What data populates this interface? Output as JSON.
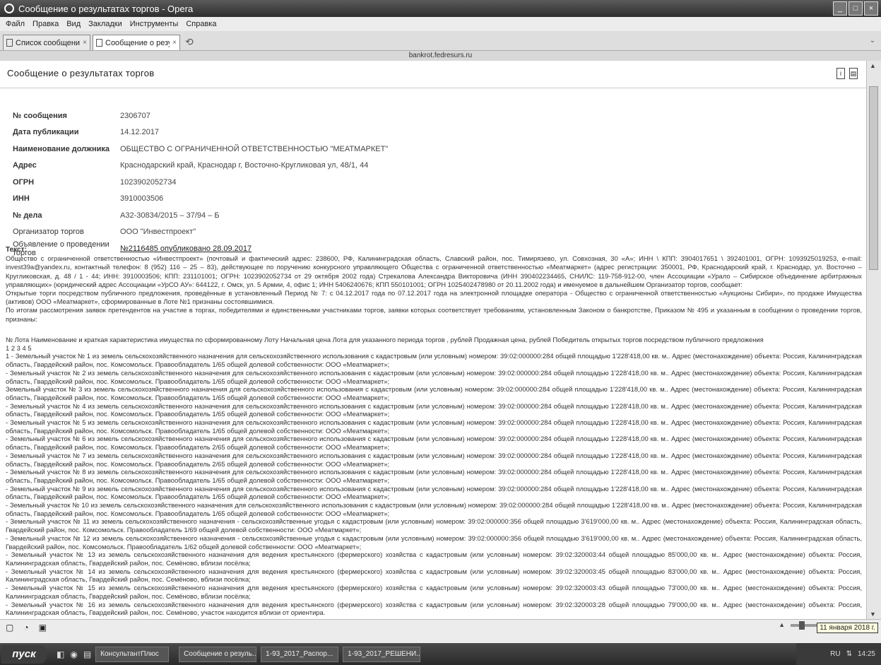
{
  "window": {
    "title": "Сообщение о результатах торгов - Opera",
    "controls": [
      "_",
      "□",
      "×"
    ]
  },
  "menu": [
    "Файл",
    "Правка",
    "Вид",
    "Закладки",
    "Инструменты",
    "Справка"
  ],
  "tabs": [
    {
      "label": "Список сообщений о ба...",
      "close": "×"
    },
    {
      "label": "Сообщение о результа...",
      "close": "×"
    }
  ],
  "address": "bankrot.fedresurs.ru",
  "page": {
    "title": "Сообщение о результатах торгов",
    "fields": [
      {
        "label": "№ сообщения",
        "value": "2306707"
      },
      {
        "label": "Дата публикации",
        "value": "14.12.2017"
      },
      {
        "label": "Наименование должника",
        "value": "ОБЩЕСТВО С ОГРАНИЧЕННОЙ ОТВЕТСТВЕННОСТЬЮ \"МЕАТМАРКЕТ\""
      },
      {
        "label": "Адрес",
        "value": "Краснодарский край, Краснодар г, Восточно-Кругликовая ул, 48/1, 44"
      },
      {
        "label": "ОГРН",
        "value": "1023902052734"
      },
      {
        "label": "ИНН",
        "value": "3910003506"
      },
      {
        "label": "№ дела",
        "value": "А32-30834/2015 – 37/94 – Б"
      },
      {
        "label": "Организатор торгов",
        "value": "ООО \"Инвестпроект\""
      },
      {
        "label": "Объявление о проведении торгов",
        "value": "№2116485 опубликовано 28.09.2017"
      }
    ],
    "text_heading": "Текст:",
    "text_paragraphs": [
      "Общество с ограниченной ответственностью «Инвестпроект» (почтовый и фактический адрес: 238600, РФ, Калининградская область, Славский район, пос. Тимирязево, ул. Совхозная, 30 «А»; ИНН \\ КПП: 3904017651 \\ 392401001, ОГРН: 1093925019253, e-mail: invest39a@yandex.ru, контактный телефон: 8 (952) 116 – 25 – 83), действующее по поручению конкурсного управляющего Общества с ограниченной ответственностью «Меатмаркет» (адрес регистрации: 350001, РФ, Краснодарский край, г. Краснодар, ул. Восточно – Кругликовская, д. 48 / 1 - 44; ИНН: 3910003506; КПП: 231101001; ОГРН: 1023902052734 от 29 октября 2002 года) Стрекалова Александра Викторовича (ИНН 390402234465, СНИЛС: 119-758-912-00, член Ассоциации «Урало – Сибирское объединение арбитражных управляющих» (юридический адрес Ассоциации «УрСО АУ»: 644122, г. Омск, ул. 5 Армии, 4, офис 1; ИНН 5406240676; КПП 550101001; ОГРН 1025402478980 от 20.11.2002 года) и именуемое в дальнейшем Организатор торгов, сообщает:",
      "Открытые торги посредством публичного предложения, проведённые в установленный Период № 7: с 04.12.2017 года по 07.12.2017 года на электронной площадке оператора - Общество с ограниченной ответственностью «Аукционы Сибири», по продаже Имущества (активов) ООО «Меатмаркет», сформированные в Лоте №1 признаны состоявшимися.",
      "По итогам рассмотрения заявок претендентов на участие в торгах, победителями и единственными участниками торгов, заявки которых соответствует требованиям, установленным Законом о банкротстве, Приказом № 495 и указанным в сообщении о проведении торгов, признаны:"
    ],
    "table_header": "№ Лота Наименование и краткая характеристика имущества по сформированному Лоту Начальная цена Лота для указанного периода торгов , рублей Продажная цена, рублей Победитель открытых торгов посредством публичного предложения",
    "table_columns": "1 2 3 4 5",
    "lots": [
      "1 - Земельный участок № 1 из земель сельскохозяйственного назначения для сельскохозяйственного использования с кадастровым (или условным) номером: 39:02:000000:284 общей площадью 1'228'418,00 кв. м.. Адрес (местонахождение) объекта: Россия, Калининградская область, Гвардейский район, пос. Комсомольск. Правообладатель 1/65 общей долевой собственности: ООО «Меатмаркет»;",
      "- Земельный участок № 2 из земель сельскохозяйственного назначения для сельскохозяйственного использования с кадастровым (или условным) номером: 39:02:000000:284 общей площадью 1'228'418,00 кв. м.. Адрес (местонахождение) объекта: Россия, Калининградская область, Гвардейский район, пос. Комсомольск. Правообладатель 1/65 общей долевой собственности: ООО «Меатмаркет»;",
      "Земельный участок № 3 из земель сельскохозяйственного назначения для сельскохозяйственного использования с кадастровым (или условным) номером: 39:02:000000:284 общей площадью 1'228'418,00 кв. м.. Адрес (местонахождение) объекта: Россия, Калининградская область, Гвардейский район, пос. Комсомольск. Правообладатель 1/65 общей долевой собственности: ООО «Меатмаркет»;",
      "- Земельный участок № 4 из земель сельскохозяйственного назначения для сельскохозяйственного использования с кадастровым (или условным) номером: 39:02:000000:284 общей площадью 1'228'418,00 кв. м.. Адрес (местонахождение) объекта: Россия, Калининградская область, Гвардейский район, пос. Комсомольск. Правообладатель 1/65 общей долевой собственности: ООО «Меатмаркет»;",
      "- Земельный участок № 5 из земель сельскохозяйственного назначения для сельскохозяйственного использования с кадастровым (или условным) номером: 39:02:000000:284 общей площадью 1'228'418,00 кв. м.. Адрес (местонахождение) объекта: Россия, Калининградская область, Гвардейский район, пос. Комсомольск. Правообладатель 1/65 общей долевой собственности: ООО «Меатмаркет»;",
      "- Земельный участок № 6 из земель сельскохозяйственного назначения для сельскохозяйственного использования с кадастровым (или условным) номером: 39:02:000000:284 общей площадью 1'228'418,00 кв. м.. Адрес (местонахождение) объекта: Россия, Калининградская область, Гвардейский район, пос. Комсомольск. Правообладатель 2/65 общей долевой собственности: ООО «Меатмаркет»;",
      "- Земельный участок № 7 из земель сельскохозяйственного назначения для сельскохозяйственного использования с кадастровым (или условным) номером: 39:02:000000:284 общей площадью 1'228'418,00 кв. м.. Адрес (местонахождение) объекта: Россия, Калининградская область, Гвардейский район, пос. Комсомольск. Правообладатель 2/65 общей долевой собственности: ООО «Меатмаркет»;",
      "- Земельный участок № 8 из земель сельскохозяйственного назначения для сельскохозяйственного использования с кадастровым (или условным) номером: 39:02:000000:284 общей площадью 1'228'418,00 кв. м.. Адрес (местонахождение) объекта: Россия, Калининградская область, Гвардейский район, пос. Комсомольск. Правообладатель 1/65 общей долевой собственности: ООО «Меатмаркет»;",
      "- Земельный участок № 9 из земель сельскохозяйственного назначения для сельскохозяйственного использования с кадастровым (или условным) номером: 39:02:000000:284 общей площадью 1'228'418,00 кв. м.. Адрес (местонахождение) объекта: Россия, Калининградская область, Гвардейский район, пос. Комсомольск. Правообладатель 1/65 общей долевой собственности: ООО «Меатмаркет»;",
      "- Земельный участок № 10 из земель сельскохозяйственного назначения для сельскохозяйственного использования с кадастровым (или условным) номером: 39:02:000000:284 общей площадью 1'228'418,00 кв. м.. Адрес (местонахождение) объекта: Россия, Калининградская область, Гвардейский район, пос. Комсомольск. Правообладатель 1/65 общей долевой собственности: ООО «Меатмаркет»;",
      "- Земельный участок № 11 из земель сельскохозяйственного назначения - сельскохозяйственные угодья с кадастровым (или условным) номером: 39:02:000000:356 общей площадью 3'619'000,00 кв. м.. Адрес (местонахождение) объекта: Россия, Калининградская область, Гвардейский район, пос. Комсомольск. Правообладатель 1/69 общей долевой собственности: ООО «Меатмаркет»;",
      "- Земельный участок № 12 из земель сельскохозяйственного назначения - сельскохозяйственные угодья с кадастровым (или условным) номером: 39:02:000000:356 общей площадью 3'619'000,00 кв. м.. Адрес (местонахождение) объекта: Россия, Калининградская область, Гвардейский район, пос. Комсомольск. Правообладатель 1/62 общей долевой собственности: ООО «Меатмаркет»;",
      "- Земельный участок № 13 из земель сельскохозяйственного назначения для ведения крестьянского (фермерского) хозяйства с кадастровым (или условным) номером: 39:02:320003:44 общей площадью 85'000,00 кв. м.. Адрес (местонахождение) объекта: Россия, Калининградская область, Гвардейский район, пос. Семёново, вблизи посёлка;",
      "- Земельный участок № 14 из земель сельскохозяйственного назначения для ведения крестьянского (фермерского) хозяйства с кадастровым (или условным) номером: 39:02:320003:45 общей площадью 83'000,00 кв. м.. Адрес (местонахождение) объекта: Россия, Калининградская область, Гвардейский район, пос. Семёново, вблизи посёлка;",
      "- Земельный участок № 15 из земель сельскохозяйственного назначения для ведения крестьянского (фермерского) хозяйства с кадастровым (или условным) номером: 39:02:320003:43 общей площадью 73'000,00 кв. м.. Адрес (местонахождение) объекта: Россия, Калининградская область, Гвардейский район, пос. Семёново, вблизи посёлка;",
      "- Земельный участок № 16 из земель сельскохозяйственного назначения для ведения крестьянского (фермерского) хозяйства с кадастровым (или условным) номером: 39:02:320003:28 общей площадью 79'000,00 кв. м.. Адрес (местонахождение) объекта: Россия, Калининградская область, Гвардейский район, пос. Семёново, участок находится вблизи от ориентира."
    ]
  },
  "statusbar": {
    "date_tooltip": "11 января 2018 г."
  },
  "taskbar": {
    "start_label": "пуск",
    "buttons": [
      "КонсультантПлюс",
      "Сообщение о резуль...",
      "1-93_2017_Распор...",
      "1-93_2017_РЕШЕНИ..."
    ],
    "tray_lang": "RU",
    "tray_time": "14:25"
  }
}
